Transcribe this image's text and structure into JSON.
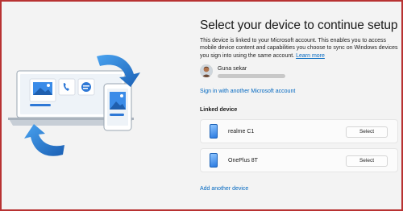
{
  "setup": {
    "title": "Select your device to continue setup",
    "description": "This device is linked to your Microsoft account. This enables you to access mobile device content and capabilities you choose to sync on Windows devices you sign into using the same account.",
    "learn_more": "Learn more"
  },
  "account": {
    "name": "Guna sekar",
    "email_redacted": true,
    "sign_in_other": "Sign in with another Microsoft account"
  },
  "linked_devices": {
    "heading": "Linked device",
    "devices": [
      {
        "name": "realme C1",
        "action": "Select"
      },
      {
        "name": "OnePlus 8T",
        "action": "Select"
      }
    ],
    "add_device": "Add another device"
  },
  "colors": {
    "accent": "#0067c0",
    "frame": "#b83232",
    "background": "#f3f3f3"
  },
  "icons": [
    "laptop-illustration-icon",
    "phone-illustration-icon",
    "sync-arrow-icon",
    "phone-icon"
  ]
}
